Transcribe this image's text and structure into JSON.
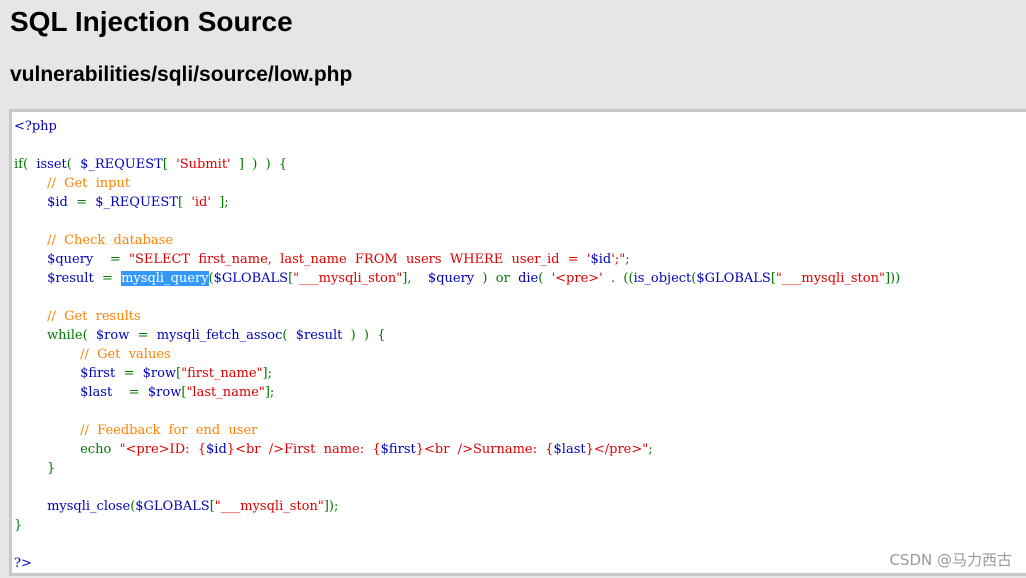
{
  "header": {
    "title": "SQL Injection Source",
    "path": "vulnerabilities/sqli/source/low.php"
  },
  "colors": {
    "default": "#0000bb",
    "keyword": "#007700",
    "string": "#dd0000",
    "comment": "#ff8000",
    "selection": "#3399ff"
  },
  "code": {
    "lines": [
      [
        {
          "t": "default",
          "s": "<?php"
        }
      ],
      [],
      [
        {
          "t": "keyword",
          "s": "if(  "
        },
        {
          "t": "default",
          "s": "isset"
        },
        {
          "t": "keyword",
          "s": "(  "
        },
        {
          "t": "default",
          "s": "$_REQUEST"
        },
        {
          "t": "keyword",
          "s": "[  "
        },
        {
          "t": "string",
          "s": "'Submit'"
        },
        {
          "t": "keyword",
          "s": "  ]  )  )  {"
        }
      ],
      [
        {
          "t": "keyword",
          "s": "        "
        },
        {
          "t": "comment",
          "s": "//  Get  input"
        }
      ],
      [
        {
          "t": "keyword",
          "s": "        "
        },
        {
          "t": "default",
          "s": "$id  "
        },
        {
          "t": "keyword",
          "s": "=  "
        },
        {
          "t": "default",
          "s": "$_REQUEST"
        },
        {
          "t": "keyword",
          "s": "[  "
        },
        {
          "t": "string",
          "s": "'id'"
        },
        {
          "t": "keyword",
          "s": "  ];"
        }
      ],
      [],
      [
        {
          "t": "keyword",
          "s": "        "
        },
        {
          "t": "comment",
          "s": "//  Check  database"
        }
      ],
      [
        {
          "t": "keyword",
          "s": "        "
        },
        {
          "t": "default",
          "s": "$query    "
        },
        {
          "t": "keyword",
          "s": "=  "
        },
        {
          "t": "string",
          "s": "\"SELECT  first_name,  last_name  FROM  users  WHERE  user_id  =  '"
        },
        {
          "t": "default",
          "s": "$id"
        },
        {
          "t": "string",
          "s": "';\""
        },
        {
          "t": "keyword",
          "s": ";"
        }
      ],
      [
        {
          "t": "keyword",
          "s": "        "
        },
        {
          "t": "default",
          "s": "$result  "
        },
        {
          "t": "keyword",
          "s": "=  "
        },
        {
          "t": "highlight",
          "s": "mysqli_query"
        },
        {
          "t": "keyword",
          "s": "("
        },
        {
          "t": "default",
          "s": "$GLOBALS"
        },
        {
          "t": "keyword",
          "s": "["
        },
        {
          "t": "string",
          "s": "\"___mysqli_ston\""
        },
        {
          "t": "keyword",
          "s": "],    "
        },
        {
          "t": "default",
          "s": "$query  "
        },
        {
          "t": "keyword",
          "s": ")  or  "
        },
        {
          "t": "default",
          "s": "die"
        },
        {
          "t": "keyword",
          "s": "(  "
        },
        {
          "t": "string",
          "s": "'<pre>'  "
        },
        {
          "t": "keyword",
          "s": ".  (("
        },
        {
          "t": "default",
          "s": "is_object"
        },
        {
          "t": "keyword",
          "s": "("
        },
        {
          "t": "default",
          "s": "$GLOBALS"
        },
        {
          "t": "keyword",
          "s": "["
        },
        {
          "t": "string",
          "s": "\"___mysqli_ston\""
        },
        {
          "t": "keyword",
          "s": "]))"
        }
      ],
      [],
      [
        {
          "t": "keyword",
          "s": "        "
        },
        {
          "t": "comment",
          "s": "//  Get  results"
        }
      ],
      [
        {
          "t": "keyword",
          "s": "        while(  "
        },
        {
          "t": "default",
          "s": "$row  "
        },
        {
          "t": "keyword",
          "s": "=  "
        },
        {
          "t": "default",
          "s": "mysqli_fetch_assoc"
        },
        {
          "t": "keyword",
          "s": "(  "
        },
        {
          "t": "default",
          "s": "$result  "
        },
        {
          "t": "keyword",
          "s": ")  )  {"
        }
      ],
      [
        {
          "t": "keyword",
          "s": "                "
        },
        {
          "t": "comment",
          "s": "//  Get  values"
        }
      ],
      [
        {
          "t": "keyword",
          "s": "                "
        },
        {
          "t": "default",
          "s": "$first  "
        },
        {
          "t": "keyword",
          "s": "=  "
        },
        {
          "t": "default",
          "s": "$row"
        },
        {
          "t": "keyword",
          "s": "["
        },
        {
          "t": "string",
          "s": "\"first_name\""
        },
        {
          "t": "keyword",
          "s": "];"
        }
      ],
      [
        {
          "t": "keyword",
          "s": "                "
        },
        {
          "t": "default",
          "s": "$last    "
        },
        {
          "t": "keyword",
          "s": "=  "
        },
        {
          "t": "default",
          "s": "$row"
        },
        {
          "t": "keyword",
          "s": "["
        },
        {
          "t": "string",
          "s": "\"last_name\""
        },
        {
          "t": "keyword",
          "s": "];"
        }
      ],
      [],
      [
        {
          "t": "keyword",
          "s": "                "
        },
        {
          "t": "comment",
          "s": "//  Feedback  for  end  user"
        }
      ],
      [
        {
          "t": "keyword",
          "s": "                echo  "
        },
        {
          "t": "string",
          "s": "\"<pre>ID:  {"
        },
        {
          "t": "default",
          "s": "$id"
        },
        {
          "t": "string",
          "s": "}<br  />First  name:  {"
        },
        {
          "t": "default",
          "s": "$first"
        },
        {
          "t": "string",
          "s": "}<br  />Surname:  {"
        },
        {
          "t": "default",
          "s": "$last"
        },
        {
          "t": "string",
          "s": "}</pre>\""
        },
        {
          "t": "keyword",
          "s": ";"
        }
      ],
      [
        {
          "t": "keyword",
          "s": "        }"
        }
      ],
      [],
      [
        {
          "t": "keyword",
          "s": "        "
        },
        {
          "t": "default",
          "s": "mysqli_close"
        },
        {
          "t": "keyword",
          "s": "("
        },
        {
          "t": "default",
          "s": "$GLOBALS"
        },
        {
          "t": "keyword",
          "s": "["
        },
        {
          "t": "string",
          "s": "\"___mysqli_ston\""
        },
        {
          "t": "keyword",
          "s": "]);"
        }
      ],
      [
        {
          "t": "keyword",
          "s": "}"
        }
      ],
      [],
      [
        {
          "t": "default",
          "s": "?>"
        }
      ]
    ]
  },
  "watermark": "CSDN @马力西古"
}
